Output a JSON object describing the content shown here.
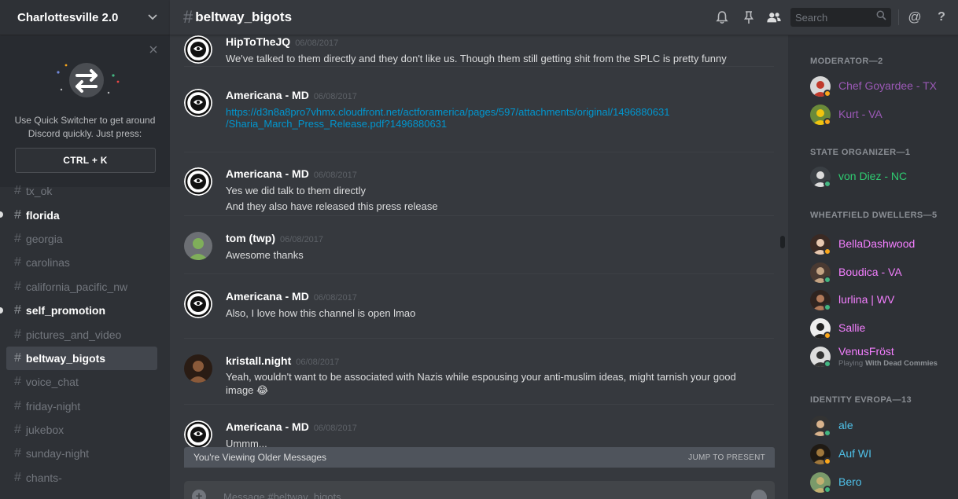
{
  "server": {
    "name": "Charlottesville 2.0"
  },
  "quick_switcher": {
    "text_line1": "Use Quick Switcher to get around",
    "text_line2": "Discord quickly. Just press:",
    "shortcut": "CTRL + K"
  },
  "channels": [
    {
      "name": "tx_ok",
      "state": "muted"
    },
    {
      "name": "florida",
      "state": "unread"
    },
    {
      "name": "georgia",
      "state": "normal"
    },
    {
      "name": "carolinas",
      "state": "normal"
    },
    {
      "name": "california_pacific_nw",
      "state": "normal"
    },
    {
      "name": "self_promotion",
      "state": "unread"
    },
    {
      "name": "pictures_and_video",
      "state": "normal"
    },
    {
      "name": "beltway_bigots",
      "state": "active"
    },
    {
      "name": "voice_chat",
      "state": "normal"
    },
    {
      "name": "friday-night",
      "state": "normal"
    },
    {
      "name": "jukebox",
      "state": "normal"
    },
    {
      "name": "sunday-night",
      "state": "normal"
    },
    {
      "name": "chants-",
      "state": "normal"
    }
  ],
  "chat": {
    "channel_name": "beltway_bigots",
    "hash": "#",
    "search_placeholder": "Search",
    "messages": [
      {
        "author": "HipToTheJQ",
        "time": "06/08/2017",
        "lines": [
          "We've talked to them directly and they don't like us. Though them still getting shit from the SPLC is pretty funny"
        ]
      },
      {
        "author": "Americana - MD",
        "time": "06/08/2017",
        "link_lines": [
          "https://d3n8a8pro7vhmx.cloudfront.net/actforamerica/pages/597/attachments/original/1496880631",
          "/Sharia_March_Press_Release.pdf?1496880631"
        ]
      },
      {
        "author": "Americana - MD",
        "time": "06/08/2017",
        "lines": [
          "Yes we did talk to them directly",
          "And they also have released this press release"
        ]
      },
      {
        "author": "tom (twp)",
        "time": "06/08/2017",
        "lines": [
          "Awesome thanks"
        ]
      },
      {
        "author": "Americana - MD",
        "time": "06/08/2017",
        "lines": [
          "Also, I love how this channel is open lmao"
        ]
      },
      {
        "author": "kristall.night",
        "time": "06/08/2017",
        "lines": [
          "Yeah, wouldn't want to be associated with Nazis while espousing your anti-muslim ideas, might tarnish your good",
          "image 😂"
        ]
      },
      {
        "author": "Americana - MD",
        "time": "06/08/2017",
        "lines": [
          "Ummm..."
        ]
      }
    ],
    "older_banner": "You're Viewing Older Messages",
    "jump_label": "JUMP TO PRESENT",
    "composer_placeholder": "Message #beltway_bigots"
  },
  "member_list": {
    "groups": [
      {
        "header": "MODERATOR—2",
        "members": [
          {
            "name": "Chef Goyardee - TX",
            "color": "#9b59b6",
            "status": "idle"
          },
          {
            "name": "Kurt - VA",
            "color": "#9b59b6",
            "status": "idle"
          }
        ]
      },
      {
        "header": "STATE ORGANIZER—1",
        "members": [
          {
            "name": "von Diez - NC",
            "color": "#2ecc71",
            "status": "online"
          }
        ]
      },
      {
        "header": "WHEATFIELD DWELLERS—5",
        "members": [
          {
            "name": "BellaDashwood",
            "color": "#f47fff",
            "status": "idle"
          },
          {
            "name": "Boudica - VA",
            "color": "#f47fff",
            "status": "online"
          },
          {
            "name": "lurlina | WV",
            "color": "#f47fff",
            "status": "online"
          },
          {
            "name": "Sallie",
            "color": "#f47fff",
            "status": "idle"
          },
          {
            "name": "VenusFröst",
            "color": "#f47fff",
            "status": "online",
            "activity_prefix": "Playing",
            "activity_game": "With Dead Commies"
          }
        ]
      },
      {
        "header": "IDENTITY EVROPA—13",
        "members": [
          {
            "name": "ale",
            "color": "#4fc1e9",
            "status": "online"
          },
          {
            "name": "Auf WI",
            "color": "#4fc1e9",
            "status": "idle"
          },
          {
            "name": "Bero",
            "color": "#4fc1e9",
            "status": "online"
          }
        ]
      }
    ]
  },
  "colors": {
    "online": "#43b581",
    "idle": "#faa61a",
    "link": "#0096cf"
  }
}
